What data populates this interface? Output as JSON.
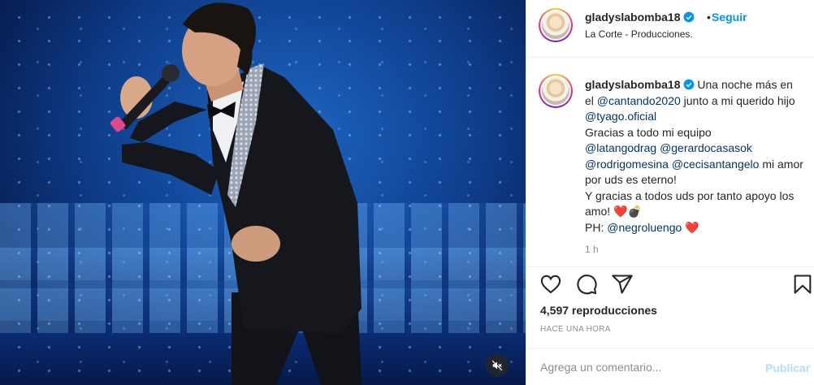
{
  "post": {
    "username": "gladyslabomba18",
    "follow_label": "Seguir",
    "separator": "•",
    "location": "La Corte - Producciones.",
    "caption_parts": [
      {
        "text": "Una noche más en el ",
        "type": "text"
      },
      {
        "text": "@cantando2020",
        "type": "mention"
      },
      {
        "text": " junto a mi querido hijo ",
        "type": "text"
      },
      {
        "text": "@tyago.oficial",
        "type": "mention"
      },
      {
        "text": "\nGracias a todo mi equipo\n",
        "type": "text"
      },
      {
        "text": "@latangodrag",
        "type": "mention"
      },
      {
        "text": " ",
        "type": "text"
      },
      {
        "text": "@gerardocasasok",
        "type": "mention"
      },
      {
        "text": "\n",
        "type": "text"
      },
      {
        "text": "@rodrigomesina",
        "type": "mention"
      },
      {
        "text": " ",
        "type": "text"
      },
      {
        "text": "@cecisantangelo",
        "type": "mention"
      },
      {
        "text": " mi amor por uds es eterno!\nY gracias a todos uds por tanto apoyo los amo! ",
        "type": "text"
      },
      {
        "text": "❤️",
        "type": "heart"
      },
      {
        "text": "💣",
        "type": "emoji"
      },
      {
        "text": "\nPH: ",
        "type": "text"
      },
      {
        "text": "@negroluengo",
        "type": "mention"
      },
      {
        "text": " ",
        "type": "text"
      },
      {
        "text": "❤️",
        "type": "heart"
      }
    ],
    "caption_time": "1 h",
    "views": "4,597 reproducciones",
    "posted_ago": "HACE UNA HORA",
    "comment_placeholder": "Agrega un comentario...",
    "publish_label": "Publicar"
  },
  "icons": {
    "like": "heart-icon",
    "comment": "comment-icon",
    "share": "share-icon",
    "save": "bookmark-icon",
    "verified": "verified-badge-icon",
    "mute": "speaker-muted-icon"
  },
  "colors": {
    "link_blue": "#0095f6",
    "mention_blue": "#00376b",
    "heart_red": "#ed4956",
    "muted_gray": "#8e8e8e",
    "publish_disabled": "#b2dffc"
  }
}
